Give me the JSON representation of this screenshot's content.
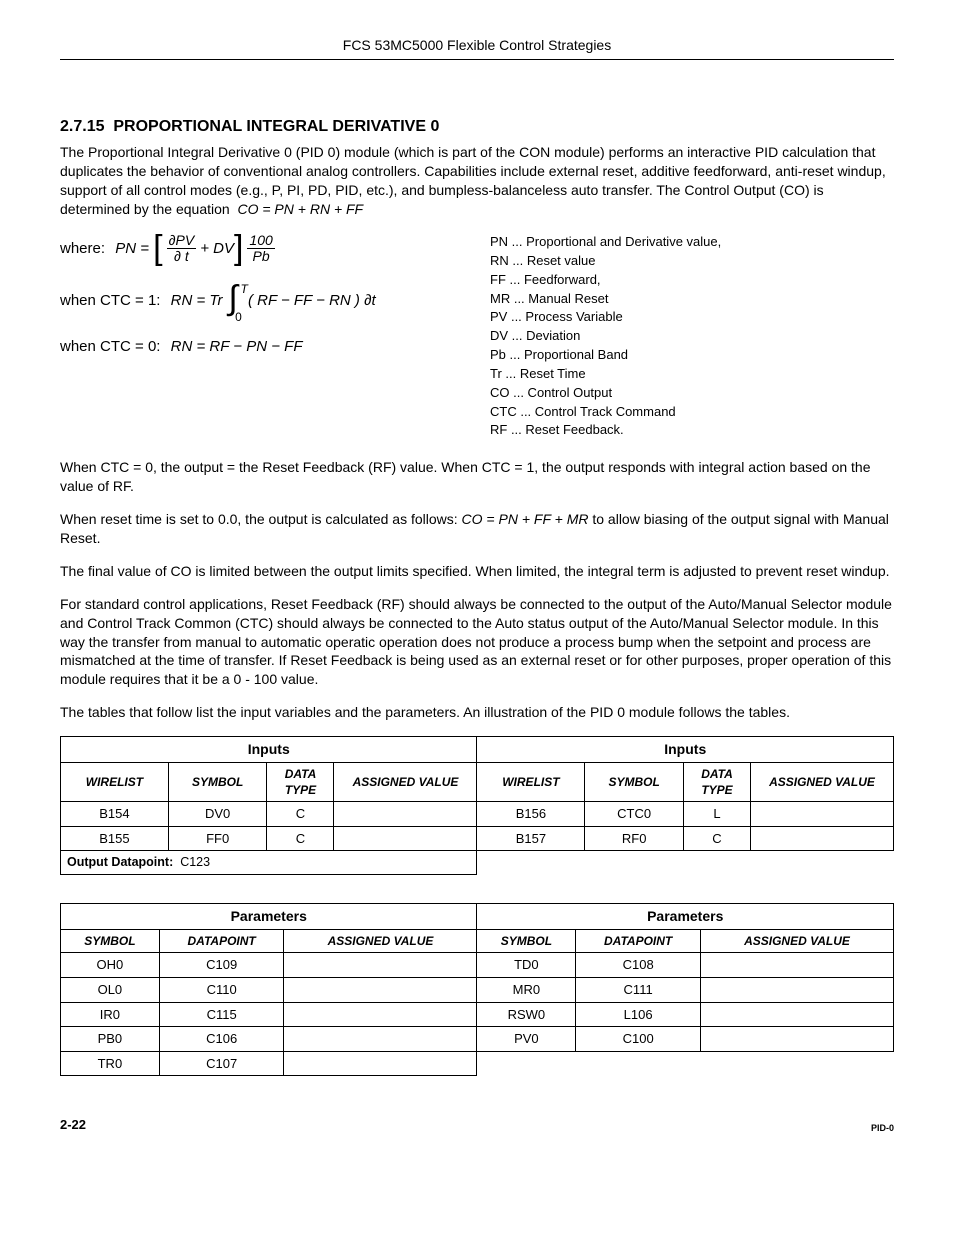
{
  "header": "FCS 53MC5000 Flexible Control Strategies",
  "section_number": "2.7.15",
  "section_title": "PROPORTIONAL INTEGRAL DERIVATIVE 0",
  "p1": "The Proportional Integral Derivative 0 (PID 0) module (which is part of the CON module) performs an interactive PID calculation that duplicates the behavior of conventional analog controllers.  Capabilities include external reset, additive feedforward, anti-reset windup, support of all control modes (e.g., P, PI, PD, PID, etc.), and bumpless-balanceless auto transfer.  The Control Output (CO) is determined by the equation",
  "eq_co": "CO = PN + RN + FF",
  "where_label": "where:",
  "eq_pn_lhs": "PN =",
  "eq_pn_frac1_num": "∂PV",
  "eq_pn_frac1_den": "∂ t",
  "eq_pn_plusdv": "+ DV",
  "eq_pn_frac2_num": "100",
  "eq_pn_frac2_den": "Pb",
  "ctc1_label": "when CTC = 1:",
  "eq_rn1_lhs": "RN = Tr",
  "eq_rn1_int_upper": "T",
  "eq_rn1_int_lower": "0",
  "eq_rn1_body": "( RF − FF − RN ) ∂t",
  "ctc0_label": "when CTC = 0:",
  "eq_rn0": "RN = RF − PN − FF",
  "legend": [
    "PN ... Proportional and Derivative value,",
    "RN ... Reset value",
    "FF ... Feedforward,",
    "MR ... Manual Reset",
    "PV ... Process Variable",
    "DV ... Deviation",
    "Pb ... Proportional Band",
    "Tr ... Reset Time",
    "CO ... Control Output",
    "CTC ... Control Track Command",
    "RF ... Reset Feedback."
  ],
  "p2": "When CTC = 0, the output = the Reset Feedback (RF) value.  When CTC = 1, the output responds with integral action based on the value of RF.",
  "p3_a": "When reset time is set to 0.0, the output is calculated as follows:",
  "p3_eq": "CO = PN + FF + MR",
  "p3_b": " to allow biasing of the output signal with Manual Reset.",
  "p4": "The final value of CO is limited between the output limits specified.  When limited, the integral term is adjusted to prevent reset windup.",
  "p5": "For standard control applications, Reset Feedback (RF) should always be connected to the output of the Auto/Manual Selector module and Control Track Common (CTC) should always be connected to the Auto status output of the Auto/Manual Selector module.  In this way the transfer from manual to automatic operatic operation does not produce a process bump when the setpoint and process are mismatched at the time of transfer.  If Reset Feedback is being used as an external reset or for other purposes, proper operation of this module requires that it be a 0 - 100 value.",
  "p6": "The tables that follow list the input variables and the parameters.  An illustration of the PID 0 module follows the tables.",
  "inputs_title": "Inputs",
  "inputs_cols": [
    "WIRELIST",
    "SYMBOL",
    "DATA TYPE",
    "ASSIGNED VALUE"
  ],
  "inputs_left": [
    {
      "wl": "B154",
      "sym": "DV0",
      "dt": "C",
      "av": ""
    },
    {
      "wl": "B155",
      "sym": "FF0",
      "dt": "C",
      "av": ""
    }
  ],
  "inputs_right": [
    {
      "wl": "B156",
      "sym": "CTC0",
      "dt": "L",
      "av": ""
    },
    {
      "wl": "B157",
      "sym": "RF0",
      "dt": "C",
      "av": ""
    }
  ],
  "output_dp_label": "Output Datapoint:",
  "output_dp_value": "C123",
  "params_title": "Parameters",
  "params_cols": [
    "SYMBOL",
    "DATAPOINT",
    "ASSIGNED VALUE"
  ],
  "params_left": [
    {
      "sym": "OH0",
      "dp": "C109",
      "av": ""
    },
    {
      "sym": "OL0",
      "dp": "C110",
      "av": ""
    },
    {
      "sym": "IR0",
      "dp": "C115",
      "av": ""
    },
    {
      "sym": "PB0",
      "dp": "C106",
      "av": ""
    },
    {
      "sym": "TR0",
      "dp": "C107",
      "av": ""
    }
  ],
  "params_right": [
    {
      "sym": "TD0",
      "dp": "C108",
      "av": ""
    },
    {
      "sym": "MR0",
      "dp": "C111",
      "av": ""
    },
    {
      "sym": "RSW0",
      "dp": "L106",
      "av": ""
    },
    {
      "sym": "PV0",
      "dp": "C100",
      "av": ""
    }
  ],
  "page_number": "2-22",
  "footer_tag": "PID-0"
}
